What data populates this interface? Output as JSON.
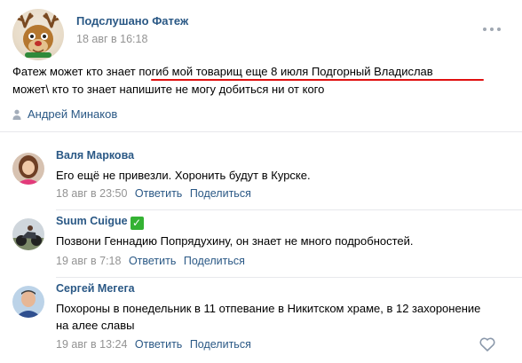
{
  "post": {
    "group_name": "Подслушано Фатеж",
    "date": "18 авг в 16:18",
    "text_line1": "Фатеж может кто знает погиб мой товарищ еще 8 июля Подгорный Владислав",
    "text_line2": "может\\ кто то знает напишите не могу добиться ни от кого",
    "signer": "Андрей Минаков",
    "more_icon": "more-dots-icon",
    "underline_color": "#e01010"
  },
  "comments": [
    {
      "author": "Валя Маркова",
      "text": "Его ещё не привезли. Хоронить будут в Курске.",
      "date": "18 авг в 23:50",
      "reply": "Ответить",
      "share": "Поделиться"
    },
    {
      "author": "Suum Cuigue",
      "badge": "✓",
      "text": "Позвони Геннадию Попрядухину, он знает не много подробностей.",
      "date": "19 авг в 7:18",
      "reply": "Ответить",
      "share": "Поделиться"
    },
    {
      "author": "Сергей Мегега",
      "text": "Похороны в понедельник в 11 отпевание в Никитском храме, в 12 захоронение на алее славы",
      "date": "19 авг в 13:24",
      "reply": "Ответить",
      "share": "Поделиться"
    }
  ],
  "colors": {
    "link": "#2a5885",
    "meta": "#939393",
    "badge": "#34b233"
  }
}
